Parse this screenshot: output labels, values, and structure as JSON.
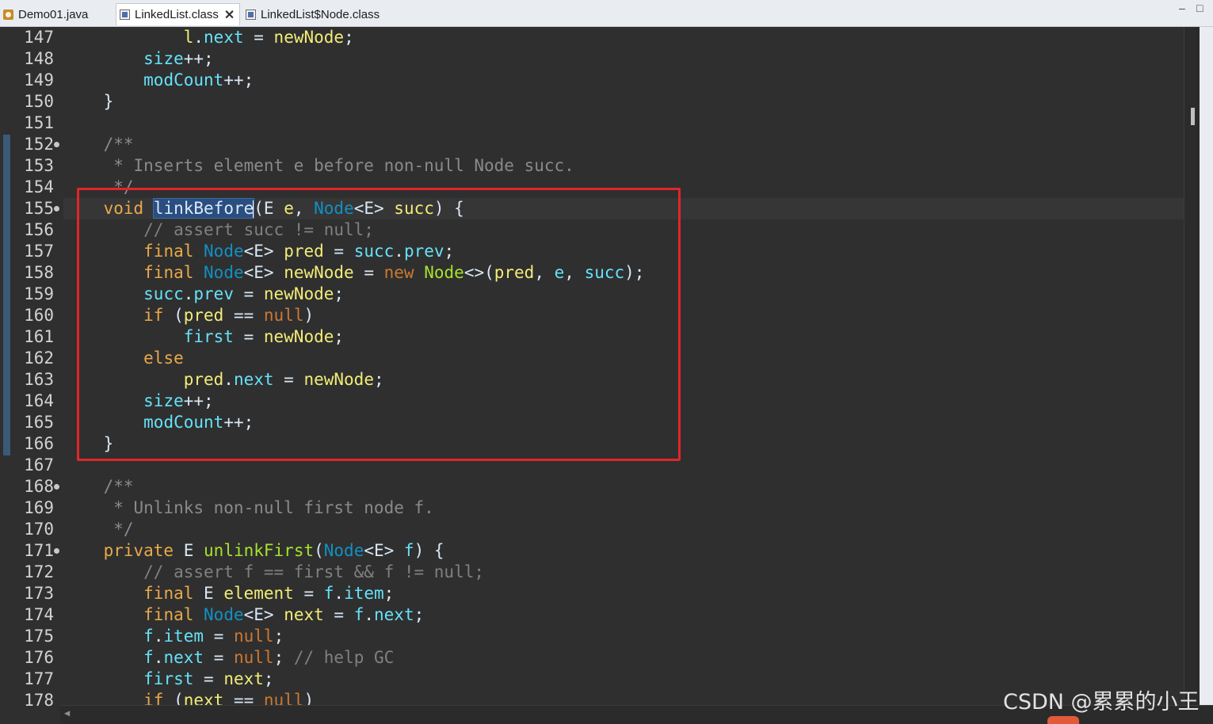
{
  "tabs": [
    {
      "label": "Demo01.java",
      "icon": "java-file-icon",
      "active": false
    },
    {
      "label": "LinkedList.class",
      "icon": "class-file-icon",
      "active": true,
      "close": "✕"
    },
    {
      "label": "LinkedList$Node.class",
      "icon": "class-file-icon",
      "active": false
    }
  ],
  "window_controls": {
    "minimize": "‒",
    "maximize": "□"
  },
  "gutter": {
    "lines": [
      "147",
      "148",
      "149",
      "150",
      "151",
      "152",
      "153",
      "154",
      "155",
      "156",
      "157",
      "158",
      "159",
      "160",
      "161",
      "162",
      "163",
      "164",
      "165",
      "166",
      "167",
      "168",
      "169",
      "170",
      "171",
      "172",
      "173",
      "174",
      "175",
      "176",
      "177",
      "178"
    ]
  },
  "code": {
    "lines": [
      "            l.next = newNode;",
      "        size++;",
      "        modCount++;",
      "    }",
      "",
      "    /**",
      "     * Inserts element e before non-null Node succ.",
      "     */",
      "    void linkBefore(E e, Node<E> succ) {",
      "        // assert succ != null;",
      "        final Node<E> pred = succ.prev;",
      "        final Node<E> newNode = new Node<>(pred, e, succ);",
      "        succ.prev = newNode;",
      "        if (pred == null)",
      "            first = newNode;",
      "        else",
      "            pred.next = newNode;",
      "        size++;",
      "        modCount++;",
      "    }",
      "",
      "    /**",
      "     * Unlinks non-null first node f.",
      "     */",
      "    private E unlinkFirst(Node<E> f) {",
      "        // assert f == first && f != null;",
      "        final E element = f.item;",
      "        final Node<E> next = f.next;",
      "        f.item = null;",
      "        f.next = null; // help GC",
      "        first = next;",
      "        if (next == null)"
    ]
  },
  "colors": {
    "background": "#2f2f2f",
    "keyword": "#cc7832",
    "type": "#1290c3",
    "field": "#66e1f8",
    "local_variable": "#f3ec79",
    "comment": "#808080",
    "selection": "#2a4e80",
    "highlight_box": "#e0262a"
  },
  "watermark": {
    "text": "CSDN @累累的小王"
  }
}
